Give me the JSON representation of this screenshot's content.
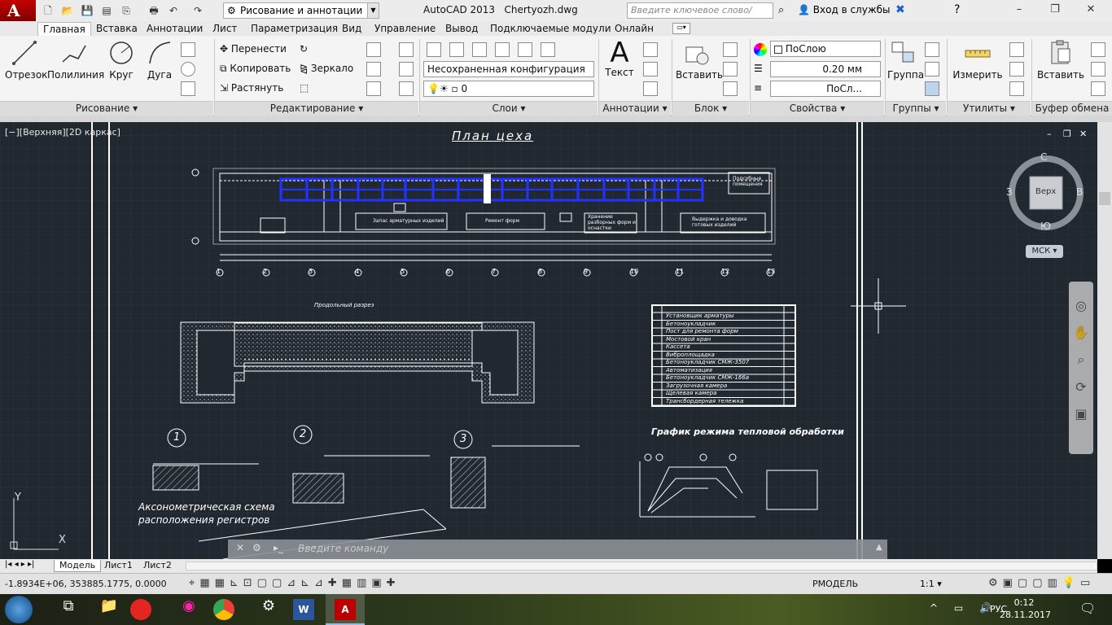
{
  "app": {
    "logo": "A",
    "title": "AutoCAD 2013",
    "filename": "Chertyozh.dwg",
    "workspace": "Рисование и аннотации",
    "search_placeholder": "Введите ключевое слово/фразу",
    "signin": "Вход в службы"
  },
  "window_controls": {
    "minimize": "–",
    "restore": "❐",
    "close": "✕"
  },
  "tabs": [
    "Главная",
    "Вставка",
    "Аннотации",
    "Лист",
    "Параметризация",
    "Вид",
    "Управление",
    "Вывод",
    "Подключаемые модули",
    "Онлайн"
  ],
  "ribbon": {
    "draw": {
      "line": "Отрезок",
      "polyline": "Полилиния",
      "circle": "Круг",
      "arc": "Дуга",
      "panel": "Рисование"
    },
    "modify": {
      "move": "Перенести",
      "copy": "Копировать",
      "stretch": "Растянуть",
      "mirror": "Зеркало",
      "panel": "Редактирование"
    },
    "layers": {
      "state": "Несохраненная конфигурация сло",
      "current": "0",
      "panel": "Слои"
    },
    "annot": {
      "text": "Текст",
      "panel": "Аннотации"
    },
    "block": {
      "insert": "Вставить",
      "panel": "Блок"
    },
    "props": {
      "color": "ПоСлою",
      "lineweight": "0.20 мм",
      "linetype": "ПоСл...",
      "panel": "Свойства"
    },
    "groups": {
      "group": "Группа",
      "panel": "Группы"
    },
    "utils": {
      "measure": "Измерить",
      "panel": "Утилиты"
    },
    "clip": {
      "paste": "Вставить",
      "panel": "Буфер обмена"
    }
  },
  "viewport": {
    "label": "[−][Верхняя][2D каркас]",
    "sheet_title": "План цеха",
    "section_title": "Продольный разрез",
    "axo_title_1": "Аксонометрическая схема",
    "axo_title_2": "расположения регистров",
    "graph_title": "График режима тепловой обработки",
    "plan_labels": {
      "room1": "Подсобные помещения",
      "room2": "Запас арматурных изделий",
      "room3": "Ремонт форм",
      "room4": "Хранение разборных форм и оснастки",
      "room5": "Выдержка и доводка готовых изделий"
    },
    "axis_numbers": [
      "1",
      "2",
      "3",
      "4",
      "5",
      "6",
      "7",
      "8",
      "9",
      "10",
      "11",
      "12",
      "13"
    ],
    "callouts": [
      "1",
      "2",
      "3"
    ],
    "spec_rows": [
      "Установщик арматуры",
      "Бетоноукладчик",
      "Пост для ремонта форм",
      "Мостовой кран",
      "Кассета",
      "Виброплощадка",
      "Бетоноукладчик СМЖ-3507",
      "Автоматизация",
      "Бетоноукладчик СМЖ-166а",
      "Загрузочная камера",
      "Щелевая камера",
      "Трансбордерная тележка"
    ],
    "viewcube": {
      "north": "С",
      "south": "Ю",
      "west": "З",
      "east": "В",
      "top": "Верх",
      "ucs": "МСК"
    },
    "ucs_y": "Y",
    "ucs_x": "X"
  },
  "command": {
    "placeholder": "Введите команду"
  },
  "layout_tabs": [
    "Модель",
    "Лист1",
    "Лист2"
  ],
  "status": {
    "coords": "-1.8934E+06, 353885.1775, 0.0000",
    "space": "РМОДЕЛЬ",
    "scale": "1:1"
  },
  "taskbar": {
    "lang": "РУС",
    "time": "0:12",
    "date": "28.11.2017"
  }
}
